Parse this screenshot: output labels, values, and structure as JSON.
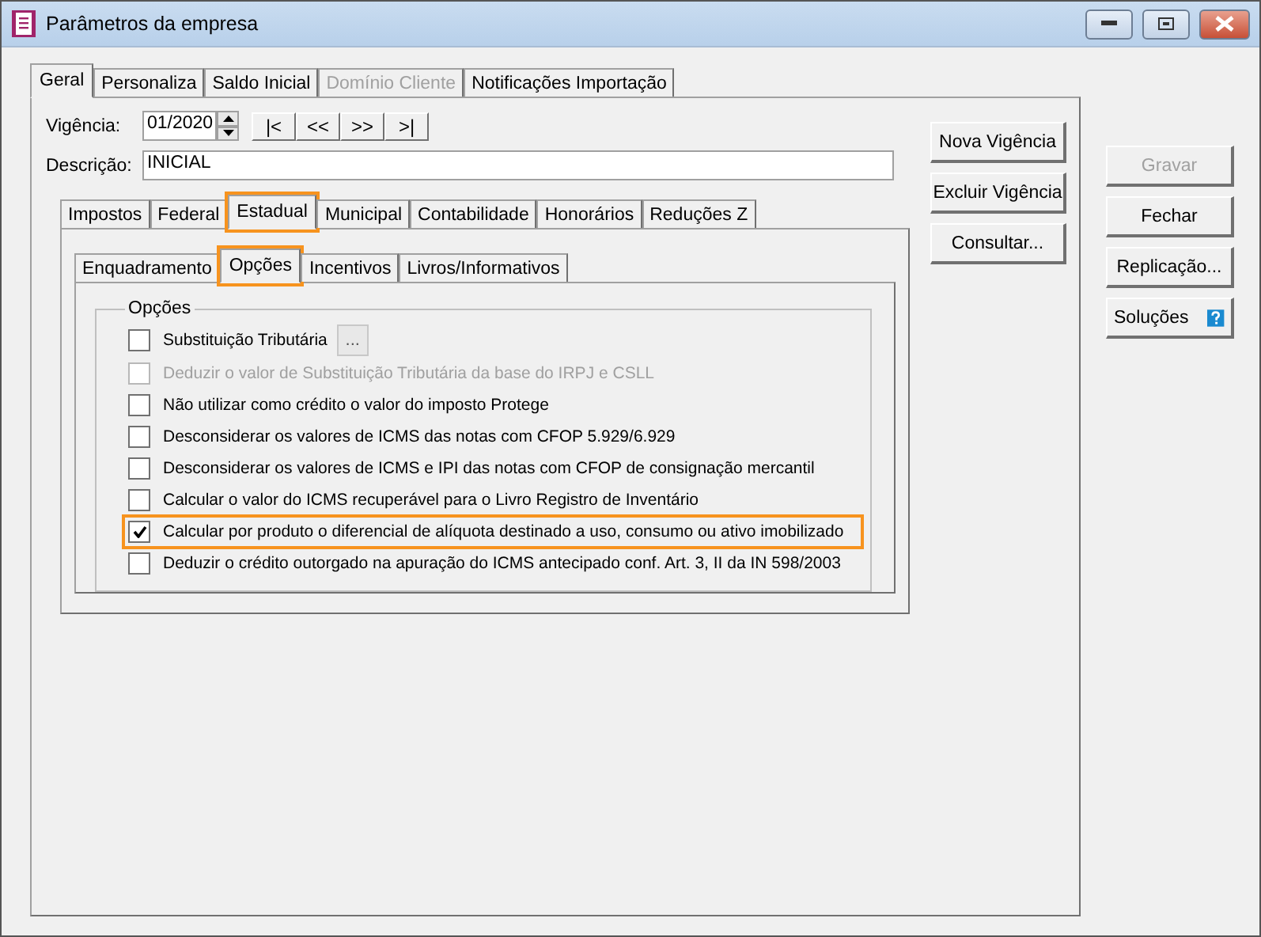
{
  "window": {
    "title": "Parâmetros da empresa"
  },
  "tabs": [
    {
      "label": "Geral",
      "selected": true,
      "disabled": false
    },
    {
      "label": "Personaliza",
      "selected": false,
      "disabled": false
    },
    {
      "label": "Saldo Inicial",
      "selected": false,
      "disabled": false
    },
    {
      "label": "Domínio Cliente",
      "selected": false,
      "disabled": true
    },
    {
      "label": "Notificações Importação",
      "selected": false,
      "disabled": false
    }
  ],
  "vigencia": {
    "label": "Vigência:",
    "value": "01/2020",
    "nav_buttons": [
      "|<",
      "<<",
      ">>",
      ">|"
    ]
  },
  "descricao": {
    "label": "Descrição:",
    "value": "INICIAL"
  },
  "vigencia_buttons": [
    "Nova Vigência",
    "Excluir Vigência",
    "Consultar..."
  ],
  "section_tabs": [
    {
      "label": "Impostos",
      "selected": false,
      "highlighted": false
    },
    {
      "label": "Federal",
      "selected": false,
      "highlighted": false
    },
    {
      "label": "Estadual",
      "selected": true,
      "highlighted": true
    },
    {
      "label": "Municipal",
      "selected": false,
      "highlighted": false
    },
    {
      "label": "Contabilidade",
      "selected": false,
      "highlighted": false
    },
    {
      "label": "Honorários",
      "selected": false,
      "highlighted": false
    },
    {
      "label": "Reduções Z",
      "selected": false,
      "highlighted": false
    }
  ],
  "sub_tabs": [
    {
      "label": "Enquadramento",
      "selected": false,
      "highlighted": false
    },
    {
      "label": "Opções",
      "selected": true,
      "highlighted": true
    },
    {
      "label": "Incentivos",
      "selected": false,
      "highlighted": false
    },
    {
      "label": "Livros/Informativos",
      "selected": false,
      "highlighted": false
    }
  ],
  "group": {
    "title": "Opções",
    "options": [
      {
        "label": "Substituição Tributária",
        "checked": false,
        "disabled": false,
        "highlighted": false,
        "button": "..."
      },
      {
        "label": "Deduzir o valor de Substituição Tributária da base do IRPJ e CSLL",
        "checked": false,
        "disabled": true,
        "highlighted": false
      },
      {
        "label": "Não utilizar como crédito o valor do imposto Protege",
        "checked": false,
        "disabled": false,
        "highlighted": false
      },
      {
        "label": "Desconsiderar os valores de ICMS das notas com CFOP 5.929/6.929",
        "checked": false,
        "disabled": false,
        "highlighted": false
      },
      {
        "label": "Desconsiderar os valores de ICMS e IPI das notas com CFOP de consignação mercantil",
        "checked": false,
        "disabled": false,
        "highlighted": false
      },
      {
        "label": "Calcular o valor do ICMS recuperável para o Livro Registro de Inventário",
        "checked": false,
        "disabled": false,
        "highlighted": false
      },
      {
        "label": "Calcular por produto o diferencial de alíquota destinado a uso, consumo ou ativo imobilizado",
        "checked": true,
        "disabled": false,
        "highlighted": true
      },
      {
        "label": "Deduzir o crédito outorgado na apuração do ICMS antecipado conf. Art. 3, II da IN 598/2003",
        "checked": false,
        "disabled": false,
        "highlighted": false
      }
    ]
  },
  "side_buttons": [
    {
      "label": "Gravar",
      "disabled": true,
      "kind": "plain"
    },
    {
      "label": "Fechar",
      "disabled": false,
      "kind": "plain"
    },
    {
      "label": "Replicação...",
      "disabled": false,
      "kind": "plain"
    },
    {
      "label": "Soluções",
      "disabled": false,
      "kind": "help"
    }
  ]
}
